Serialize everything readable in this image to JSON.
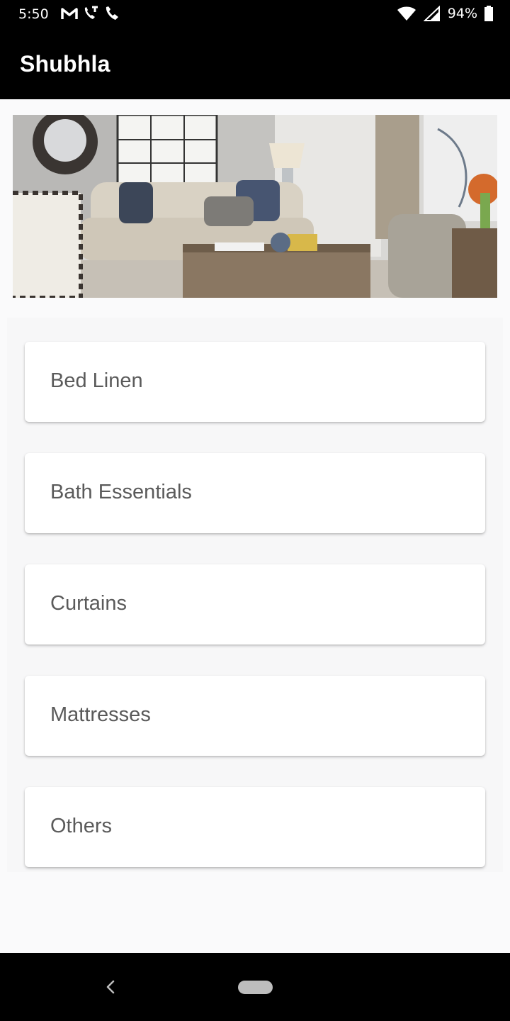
{
  "status_bar": {
    "time": "5:50",
    "battery": "94%",
    "left_icons": [
      "gmail-icon",
      "phone-voicemail-icon",
      "phone-icon"
    ],
    "right_icons": [
      "wifi-icon",
      "cell-signal-icon",
      "battery-icon"
    ]
  },
  "app_bar": {
    "title": "Shubhla"
  },
  "banner": {
    "image": "living-room-banner-image"
  },
  "categories": [
    {
      "label": "Bed Linen"
    },
    {
      "label": "Bath Essentials"
    },
    {
      "label": "Curtains"
    },
    {
      "label": "Mattresses"
    },
    {
      "label": "Others"
    }
  ],
  "nav_bar": {
    "icons": [
      "back-icon",
      "home-pill"
    ]
  },
  "colors": {
    "app_bar": "#000000",
    "background": "#fafafb",
    "card": "#ffffff",
    "label_text": "#5a5a5a"
  }
}
